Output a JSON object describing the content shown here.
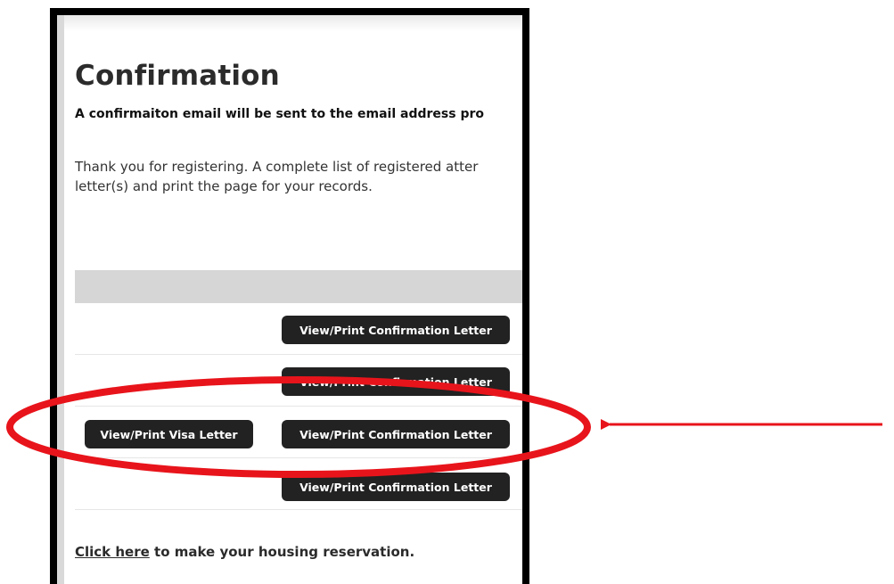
{
  "page": {
    "title": "Confirmation",
    "email_notice": "A confirmaiton email will be sent to the email address pro",
    "thanks_line1": "Thank you for registering. A complete list of registered atter",
    "thanks_line2": "letter(s) and print the page for your records."
  },
  "rows": [
    {
      "confirm_label": "View/Print Confirmation Letter"
    },
    {
      "confirm_label": "View/Print Confirmation Letter"
    },
    {
      "visa_label": "View/Print Visa Letter",
      "confirm_label": "View/Print Confirmation Letter"
    },
    {
      "confirm_label": "View/Print Confirmation Letter"
    }
  ],
  "housing": {
    "link_text": "Click here",
    "rest_text": " to make your housing reservation."
  },
  "annotation": {
    "color": "#e8141b"
  },
  "colors": {
    "button_bg": "#222222",
    "header_bar": "#d6d6d6",
    "frame": "#000000"
  }
}
